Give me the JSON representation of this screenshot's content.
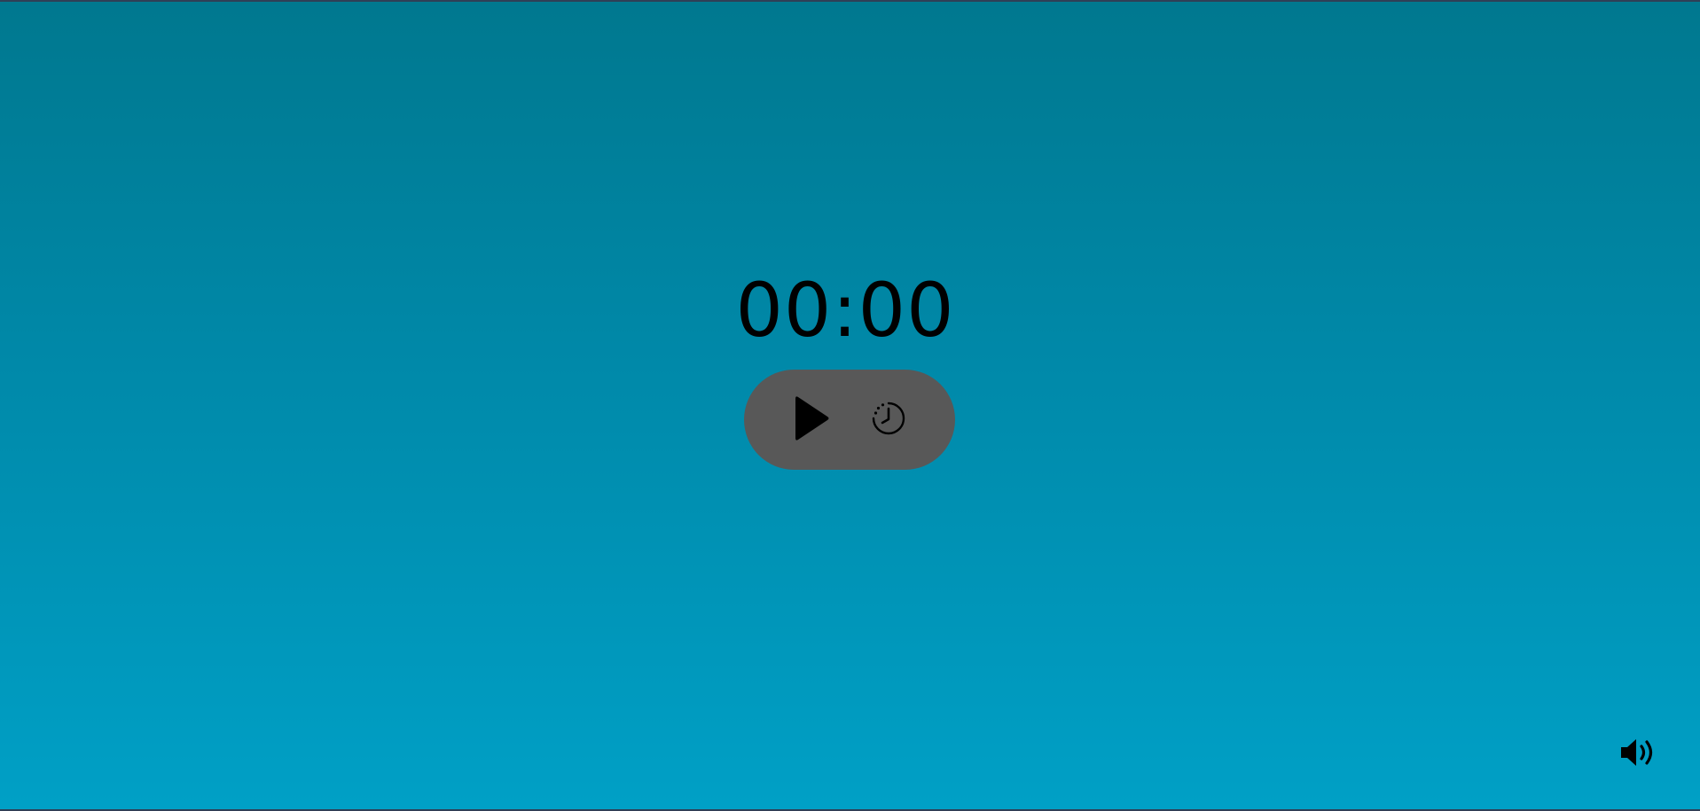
{
  "timer": {
    "display": "00:00"
  },
  "controls": {
    "play_icon": "play-icon",
    "interval_icon": "clock-interval-icon"
  },
  "volume": {
    "icon": "volume-icon"
  },
  "colors": {
    "background_top": "#00788f",
    "background_bottom": "#00a0c6",
    "pill": "#585858",
    "text": "#000000"
  }
}
